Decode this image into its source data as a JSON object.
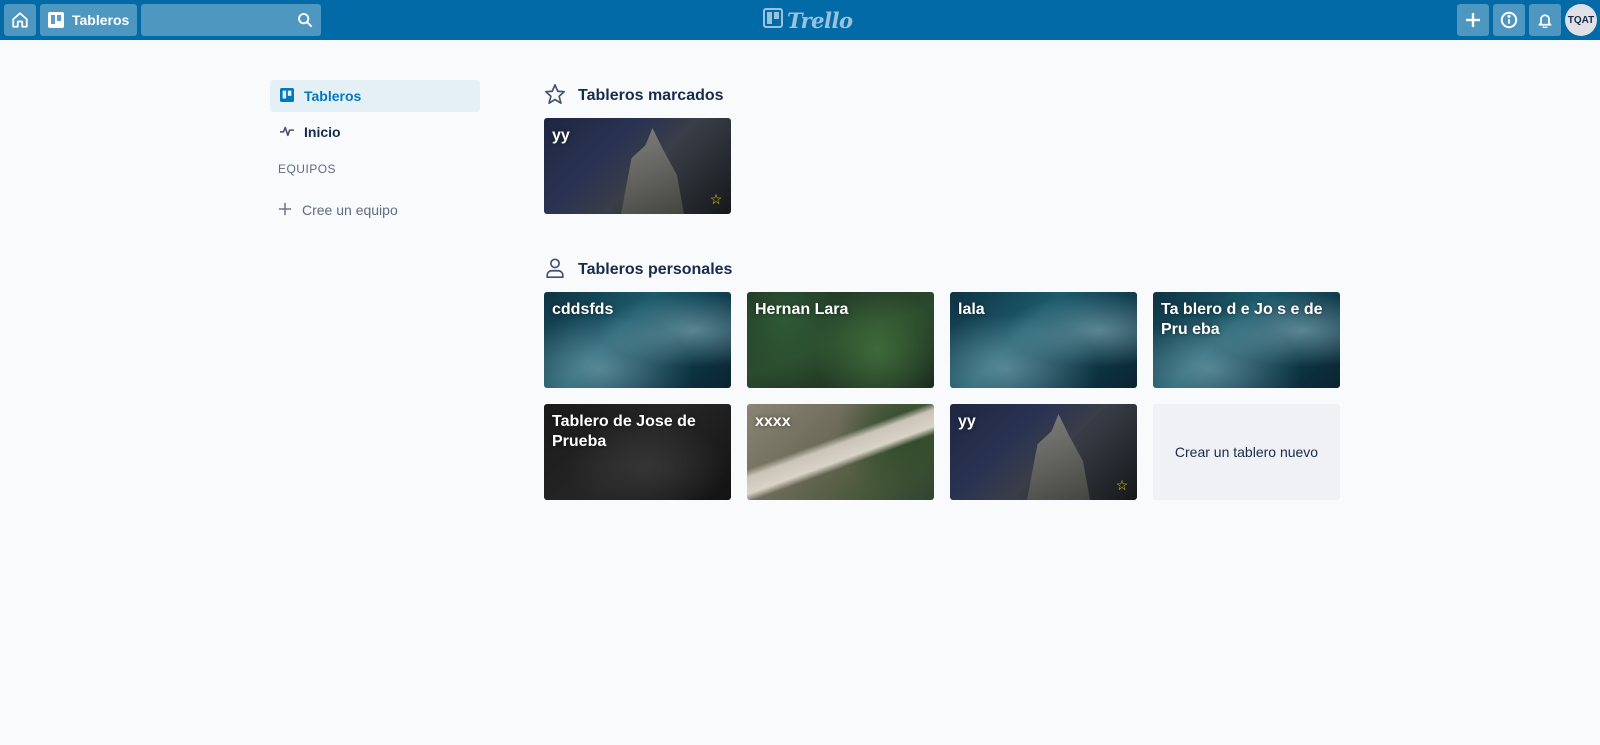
{
  "header": {
    "boards_label": "Tableros",
    "search_value": "",
    "logo_text": "Trello",
    "avatar_initials": "TQAT",
    "accent_color": "#026aa7"
  },
  "sidebar": {
    "items": [
      {
        "label": "Tableros",
        "icon": "board-icon",
        "active": true
      },
      {
        "label": "Inicio",
        "icon": "activity-icon",
        "active": false
      }
    ],
    "teams_heading": "EQUIPOS",
    "create_team_label": "Cree un equipo"
  },
  "starred": {
    "title": "Tableros marcados",
    "icon": "star-outline-icon",
    "boards": [
      {
        "title": "yy",
        "background": "night-rock",
        "starred": true
      }
    ]
  },
  "personal": {
    "title": "Tableros personales",
    "icon": "person-icon",
    "boards": [
      {
        "title": "cddsfds",
        "background": "ocean",
        "starred": false
      },
      {
        "title": "Hernan Lara",
        "background": "forest",
        "starred": false
      },
      {
        "title": "lala",
        "background": "ocean",
        "starred": false
      },
      {
        "title": "Ta blero d e Jo s e de Pru eba",
        "background": "ocean",
        "starred": false
      },
      {
        "title": "Tablero de Jose de Prueba",
        "background": "dark-rock",
        "starred": false
      },
      {
        "title": "xxxx",
        "background": "road",
        "starred": false
      },
      {
        "title": "yy",
        "background": "night-rock",
        "starred": true
      }
    ],
    "create_label": "Crear un tablero nuevo"
  }
}
